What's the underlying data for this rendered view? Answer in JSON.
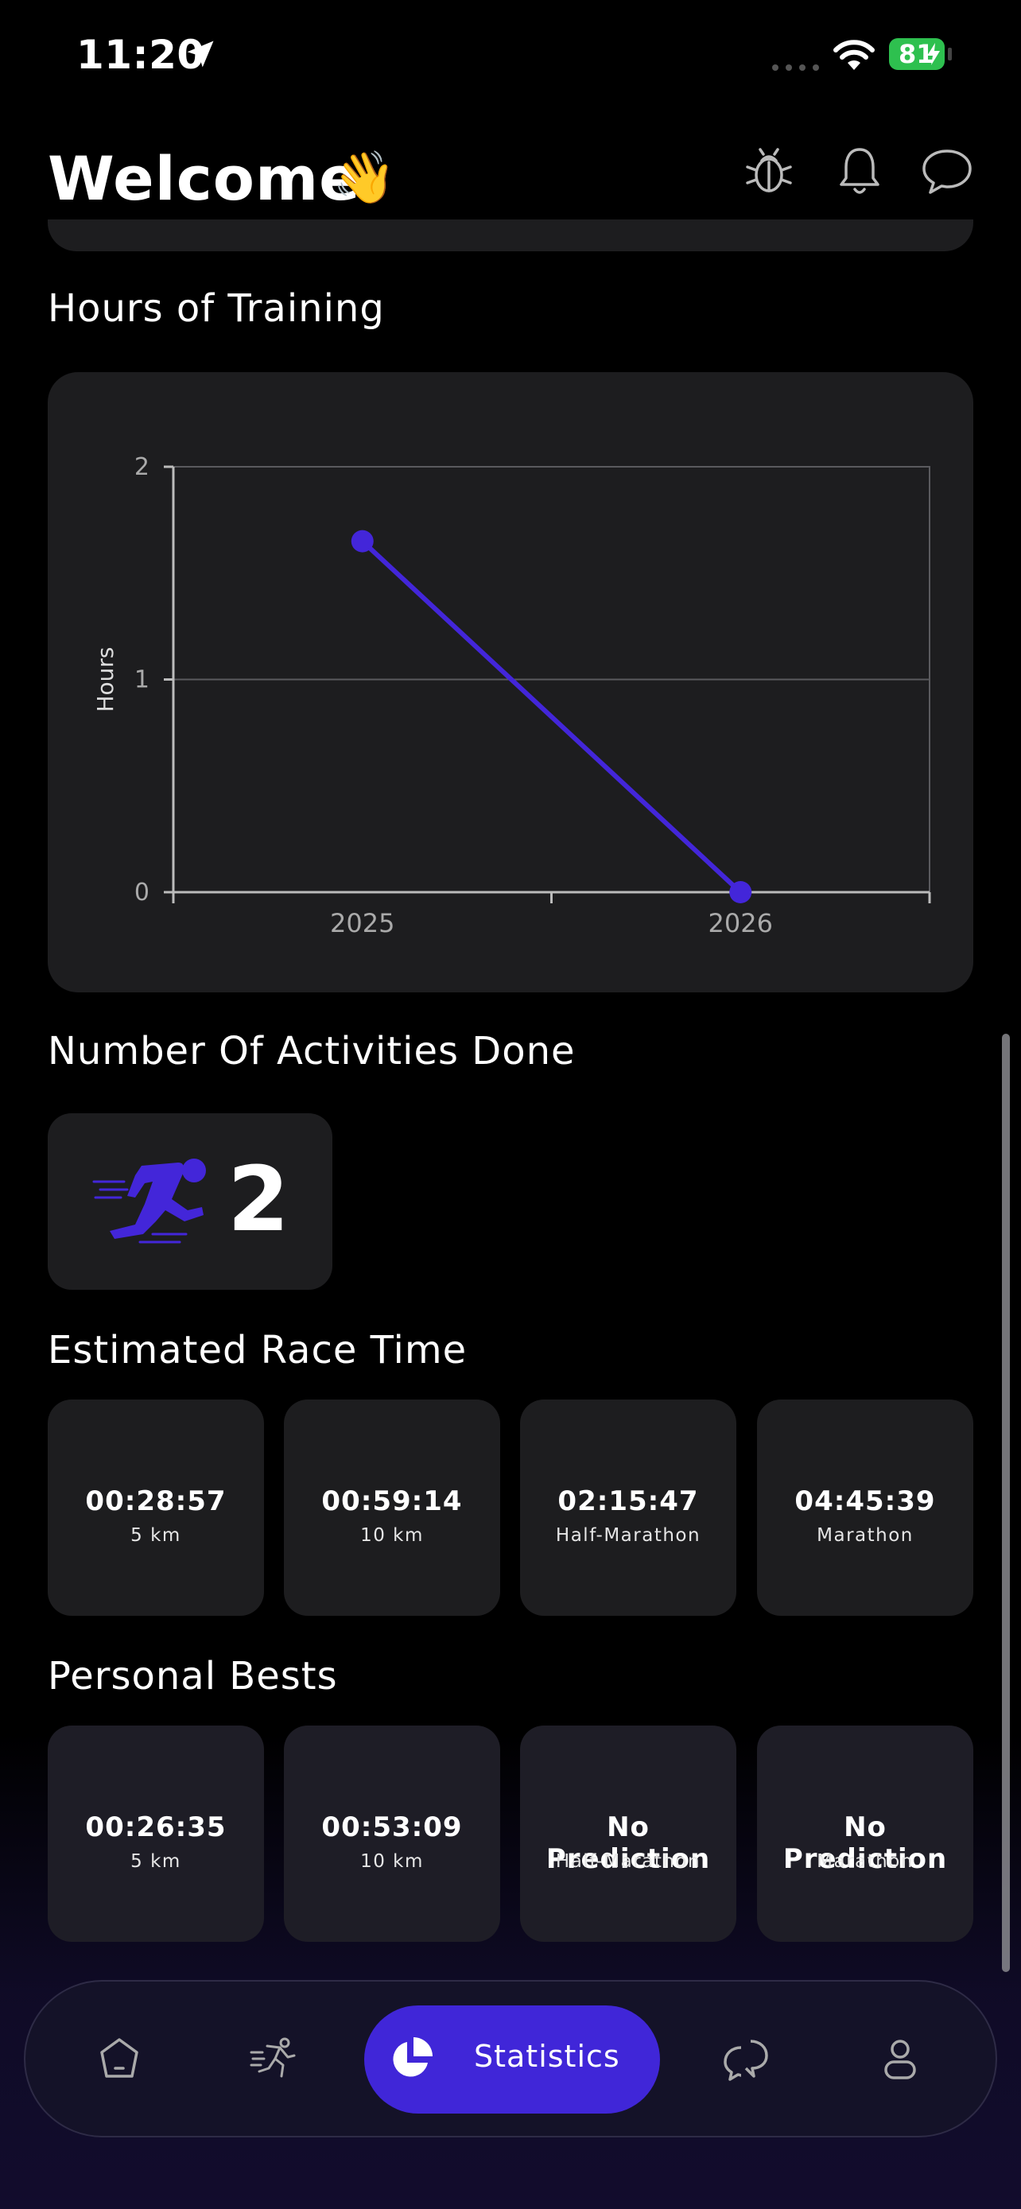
{
  "status_bar": {
    "time": "11:20",
    "battery": "81"
  },
  "header": {
    "title": "Welcome",
    "emoji": "👋"
  },
  "icons": {
    "header": [
      "bug-icon",
      "bell-icon",
      "chat-bubble-icon"
    ],
    "nav": [
      "home-icon",
      "running-icon",
      "statistics-pie-icon",
      "chat-icon",
      "profile-icon"
    ]
  },
  "sections": {
    "hours_title": "Hours of Training",
    "activities_title": "Number Of Activities Done",
    "race_title": "Estimated Race Time",
    "bests_title": "Personal Bests"
  },
  "chart_data": {
    "type": "line",
    "title": "",
    "xlabel": "",
    "ylabel": "Hours",
    "categories": [
      "2025",
      "2026"
    ],
    "series": [
      {
        "values": [
          1.65,
          0
        ]
      }
    ],
    "ylim": [
      0,
      2
    ],
    "yticks": [
      "0",
      "1",
      "2"
    ],
    "grid": true,
    "color": "#4326d9"
  },
  "activities": {
    "count": "2"
  },
  "estimated_race_times": [
    {
      "time": "00:28:57",
      "label": "5 km"
    },
    {
      "time": "00:59:14",
      "label": "10 km"
    },
    {
      "time": "02:15:47",
      "label": "Half-Marathon"
    },
    {
      "time": "04:45:39",
      "label": "Marathon"
    }
  ],
  "personal_bests": [
    {
      "time": "00:26:35",
      "label": "5 km"
    },
    {
      "time": "00:53:09",
      "label": "10 km"
    },
    {
      "time": "No Prediction",
      "label": "Half-Marathon"
    },
    {
      "time": "No Prediction",
      "label": "Marathon"
    }
  ],
  "nav": {
    "active_label": "Statistics"
  },
  "colors": {
    "accent": "#4026d8",
    "card": "#1d1d1f",
    "background": "#000000",
    "battery": "#2ec04f"
  }
}
